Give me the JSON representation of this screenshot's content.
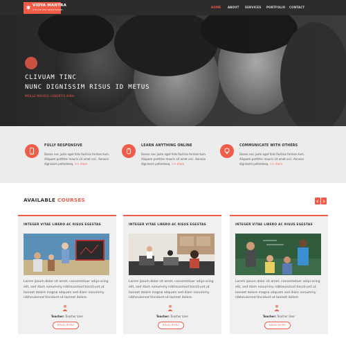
{
  "nav": {
    "brand": "VIDYA MANTRA",
    "tagline": "online education website template",
    "items": [
      {
        "label": "HOME",
        "active": true
      },
      {
        "label": "ABOUT",
        "active": false
      },
      {
        "label": "SERVICES",
        "active": false
      },
      {
        "label": "PORTFOLIO",
        "active": false
      },
      {
        "label": "CONTACT",
        "active": false
      }
    ]
  },
  "hero": {
    "line1": "CLIVUAM TINC",
    "line2": "NUNC DIGNISSIM RISUS ID METUS",
    "subtitle": "MEILLE MAURIS LOBORTIS NIBH"
  },
  "features": [
    {
      "title": "FULLY RESPONSIVE",
      "icon": "mobile-icon",
      "text": "Donec nec justo eget felis facilisis fermen-tum. Aliquam porttitor mauris sit amet orci. Aenean dignissim pellentesq.",
      "more": ">> more"
    },
    {
      "title": "LEARN ANYTHING ONLINE",
      "icon": "mouse-icon",
      "text": "Donec nec justo eget felis facilisis fermen-tum. Aliquam porttitor mauris sit amet orci. Aenean dignissim pellentesq.",
      "more": ">> more"
    },
    {
      "title": "COMMUNICATE WITH OTHERS",
      "icon": "lightbulb-icon",
      "text": "Donec nec justo eget felis facilisis fermen-tum. Aliquam porttitor mauris sit amet orci. Aenean dignissim pellentesq.",
      "more": ">> more"
    }
  ],
  "courses": {
    "title_main": "AVAILABLE",
    "title_accent": "COURSES",
    "cards": [
      {
        "title": "INTEGER VITAE LIBERO AC RISUS EGESTAS",
        "text": "Lorem ipsum dolor sit amet, consectetuer adipi-scing elit, sed diam nonummy nibheuismod tincid-unt ut laoreet dolore magna aliquam sed diam nonummy nibheuismod tincidunt ut laoreet dolore.",
        "teacher_label": "Teacher:",
        "teacher_name": "Teacher User",
        "button": "READ MORE"
      },
      {
        "title": "INTEGER VITAE LIBERO AC RISUS EGESTAS",
        "text": "Lorem ipsum dolor sit amet, consectetuer adipi-scing elit, sed diam nonummy nibheuismod tincid-unt ut laoreet dolore magna aliquam sed diam nonummy nibheuismod tincidunt ut laoreet dolore.",
        "teacher_label": "Teacher:",
        "teacher_name": "Teacher User",
        "button": "READ MORE"
      },
      {
        "title": "INTEGER VITAE LIBERO AC RISUS EGESTAS",
        "text": "Lorem ipsum dolor sit amet, consectetuer adipi-scing elit, sed diam nonummy nibheuismod tincid-unt ut laoreet dolore magna aliquam sed diam nonummy nibheuismod tincidunt ut laoreet dolore.",
        "teacher_label": "Teacher:",
        "teacher_name": "Teacher User",
        "button": "READ MORE"
      }
    ]
  },
  "colors": {
    "accent": "#f25b48",
    "nav_bg": "#2c2c2c",
    "features_bg": "#ececec",
    "card_bg": "#f0f0f0"
  }
}
